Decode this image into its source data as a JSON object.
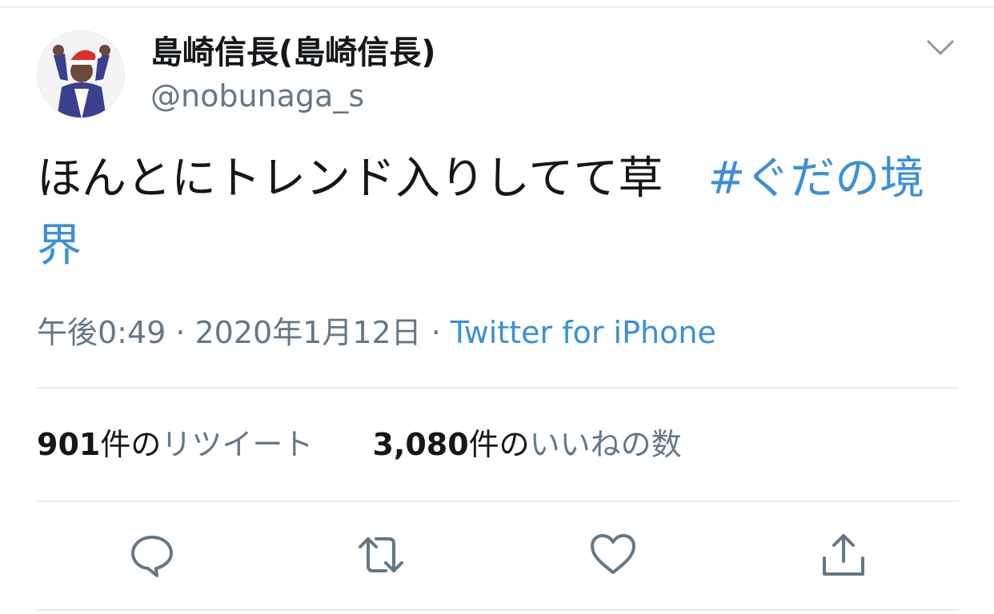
{
  "user": {
    "display_name": "島崎信長(島崎信長)",
    "handle": "@nobunaga_s",
    "avatar_icon": "avatar-santa-hat-icon"
  },
  "tweet": {
    "text": "ほんとにトレンド入りしてて草　",
    "hashtag": "#ぐだの境界",
    "time": "午後0:49",
    "date": "2020年1月12日",
    "separator": "·",
    "source": "Twitter for iPhone"
  },
  "stats": {
    "retweets": {
      "count": "901",
      "unit": "件の",
      "label": "リツイート"
    },
    "likes": {
      "count": "3,080",
      "unit": "件の",
      "label": "いいねの数"
    }
  },
  "actions": [
    {
      "name": "reply",
      "icon": "reply-bubble-icon"
    },
    {
      "name": "retweet",
      "icon": "retweet-icon"
    },
    {
      "name": "like",
      "icon": "heart-icon"
    },
    {
      "name": "share",
      "icon": "share-icon"
    }
  ],
  "colors": {
    "text": "#14171a",
    "secondary": "#657786",
    "link": "#3b8fd8",
    "divider": "#e6ecf0"
  }
}
